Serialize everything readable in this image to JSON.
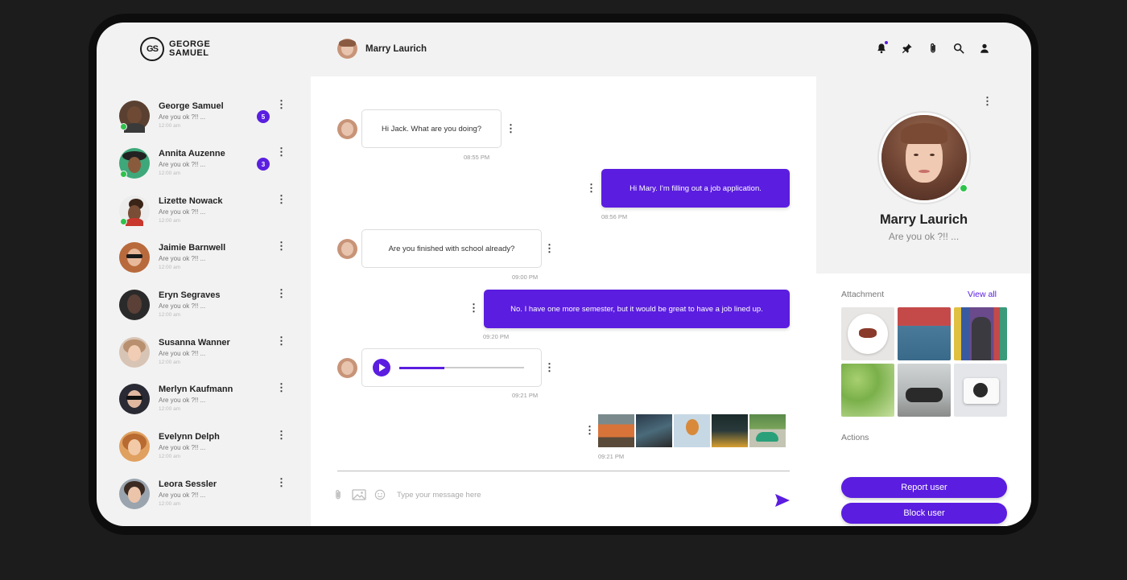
{
  "brand": {
    "logo_mark": "GS",
    "line1": "GEORGE",
    "line2": "SAMUEL"
  },
  "header": {
    "active_chat_name": "Marry Laurich",
    "icons": [
      "bell-icon",
      "pin-icon",
      "paperclip-icon",
      "search-icon",
      "user-icon"
    ]
  },
  "contacts": [
    {
      "name": "George Samuel",
      "preview": "Are you ok ?!! ...",
      "time": "12:00 am",
      "unread": "5",
      "online": true
    },
    {
      "name": "Annita Auzenne",
      "preview": "Are you ok ?!! ...",
      "time": "12:00 am",
      "unread": "3",
      "online": true
    },
    {
      "name": "Lizette Nowack",
      "preview": "Are you ok ?!! ...",
      "time": "12:00 am",
      "unread": "",
      "online": true
    },
    {
      "name": "Jaimie Barnwell",
      "preview": "Are you ok ?!! ...",
      "time": "12:00 am",
      "unread": "",
      "online": false
    },
    {
      "name": "Eryn Segraves",
      "preview": "Are you ok ?!! ...",
      "time": "12:00 am",
      "unread": "",
      "online": false
    },
    {
      "name": "Susanna Wanner",
      "preview": "Are you ok ?!! ...",
      "time": "12:00 am",
      "unread": "",
      "online": false
    },
    {
      "name": "Merlyn Kaufmann",
      "preview": "Are you ok ?!! ...",
      "time": "12:00 am",
      "unread": "",
      "online": false
    },
    {
      "name": "Evelynn Delph",
      "preview": "Are you ok ?!! ...",
      "time": "12:00 am",
      "unread": "",
      "online": false
    },
    {
      "name": "Leora Sessler",
      "preview": "Are you ok ?!! ...",
      "time": "12:00 am",
      "unread": "",
      "online": false
    }
  ],
  "messages": [
    {
      "direction": "in",
      "type": "text",
      "text": "Hi Jack. What are you doing?",
      "time": "08:55 PM"
    },
    {
      "direction": "out",
      "type": "text",
      "text": "Hi Mary. I'm filling out a job application.",
      "time": "08:56 PM"
    },
    {
      "direction": "in",
      "type": "text",
      "text": "Are you finished with school already?",
      "time": "09:00 PM"
    },
    {
      "direction": "out",
      "type": "text",
      "text": "No. I have one more semester, but it would be great to have a job lined up.",
      "time": "09:20 PM"
    },
    {
      "direction": "in",
      "type": "audio",
      "progress": 0.36,
      "time": "09:21 PM"
    },
    {
      "direction": "out",
      "type": "images",
      "count": 5,
      "time": "09:21 PM"
    }
  ],
  "composer": {
    "placeholder": "Type your message here",
    "icons": [
      "paperclip-icon",
      "image-icon",
      "emoji-icon",
      "send-icon"
    ]
  },
  "profile": {
    "name": "Marry Laurich",
    "status": "Are you ok ?!! ...",
    "attachment_label": "Attachment",
    "view_all": "View all",
    "actions_label": "Actions",
    "report_label": "Report user",
    "block_label": "Block user"
  },
  "colors": {
    "accent": "#5b1de0",
    "online": "#2ec24a",
    "background": "#1c1c1c"
  }
}
